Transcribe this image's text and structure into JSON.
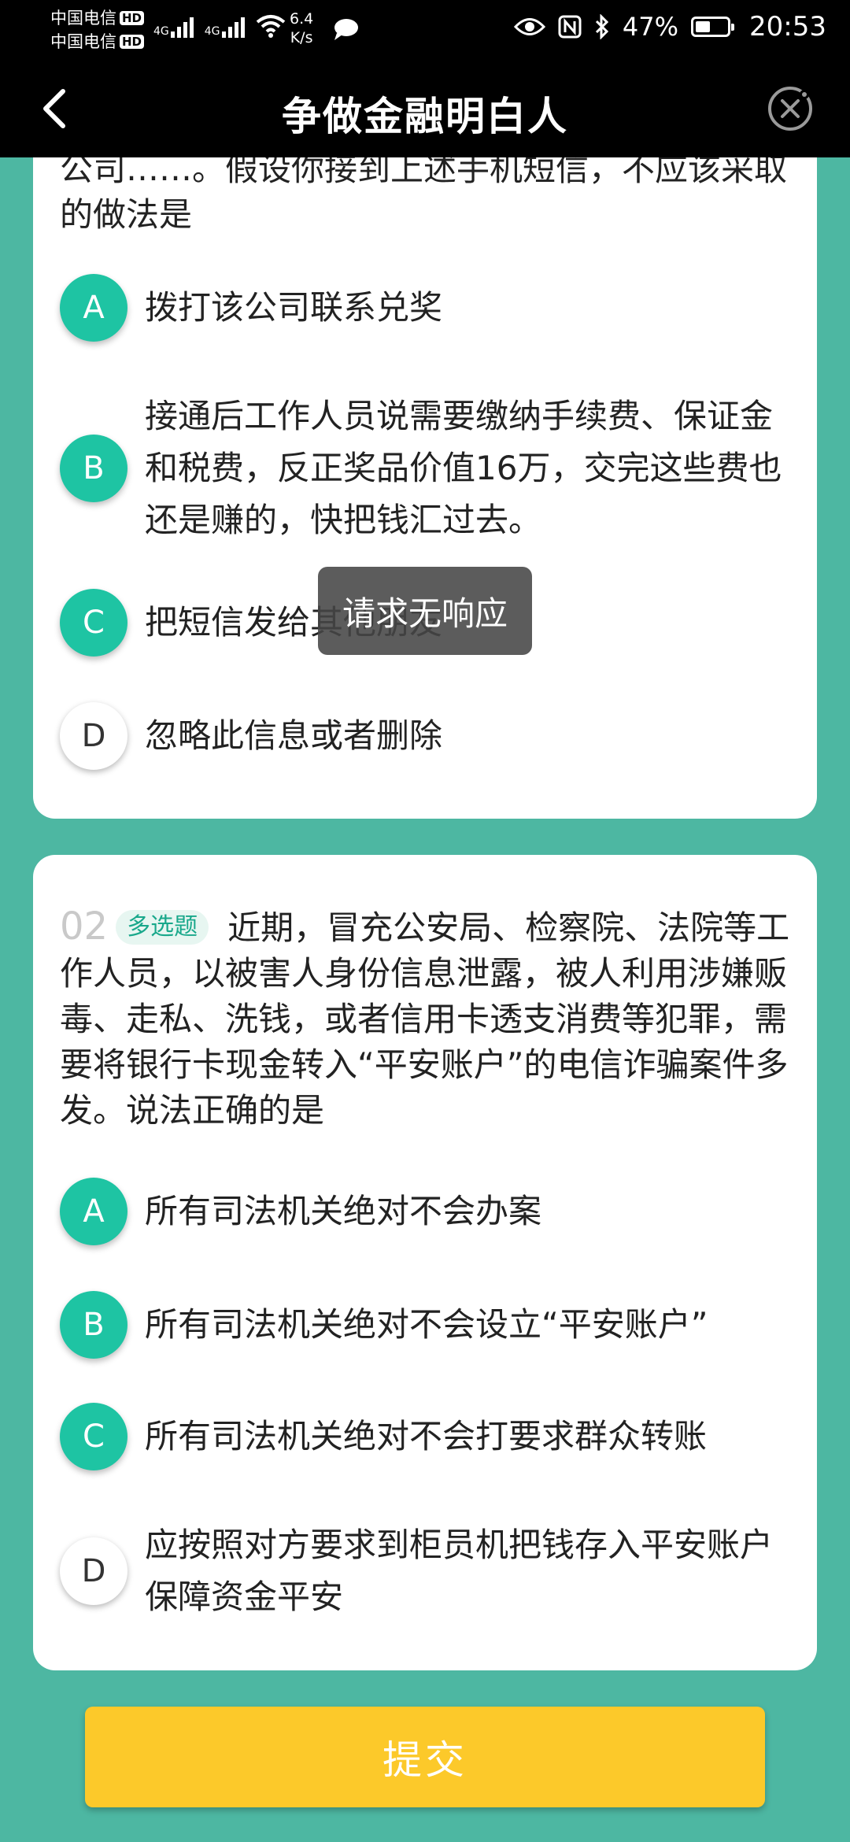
{
  "status_bar": {
    "carrier_1": "中国电信",
    "carrier_2": "中国电信",
    "hd_badge": "HD",
    "net_type_1": "4G",
    "net_type_2": "4G",
    "speed_value": "6.4",
    "speed_unit": "K/s",
    "battery_percent": "47%",
    "battery_level": 0.47,
    "time": "20:53"
  },
  "nav": {
    "title": "争做金融明白人"
  },
  "question1": {
    "text_partial": "公司……。假设你接到上述手机短信，不应该采取的做法是",
    "options": [
      {
        "letter": "A",
        "text": "拨打该公司联系兑奖",
        "selected": true
      },
      {
        "letter": "B",
        "text": "接通后工作人员说需要缴纳手续费、保证金和税费，反正奖品价值16万，交完这些费也还是赚的，快把钱汇过去。",
        "selected": true
      },
      {
        "letter": "C",
        "text": "把短信发给其他朋友",
        "selected": true
      },
      {
        "letter": "D",
        "text": "忽略此信息或者删除",
        "selected": false
      }
    ]
  },
  "question2": {
    "number": "02",
    "tag": "多选题",
    "text": "近期，冒充公安局、检察院、法院等工作人员，以被害人身份信息泄露，被人利用涉嫌贩毒、走私、洗钱，或者信用卡透支消费等犯罪，需要将银行卡现金转入“平安账户”的电信诈骗案件多发。说法正确的是",
    "options": [
      {
        "letter": "A",
        "text": "所有司法机关绝对不会办案",
        "selected": true
      },
      {
        "letter": "B",
        "text": "所有司法机关绝对不会设立“平安账户”",
        "selected": true
      },
      {
        "letter": "C",
        "text": "所有司法机关绝对不会打要求群众转账",
        "selected": true
      },
      {
        "letter": "D",
        "text": "应按照对方要求到柜员机把钱存入平安账户保障资金平安",
        "selected": false
      }
    ]
  },
  "toast": {
    "text": "请求无响应"
  },
  "submit": {
    "label": "提交"
  },
  "colors": {
    "background": "#4db7a2",
    "accent": "#1ec4a3",
    "submit": "#fcc92a"
  }
}
